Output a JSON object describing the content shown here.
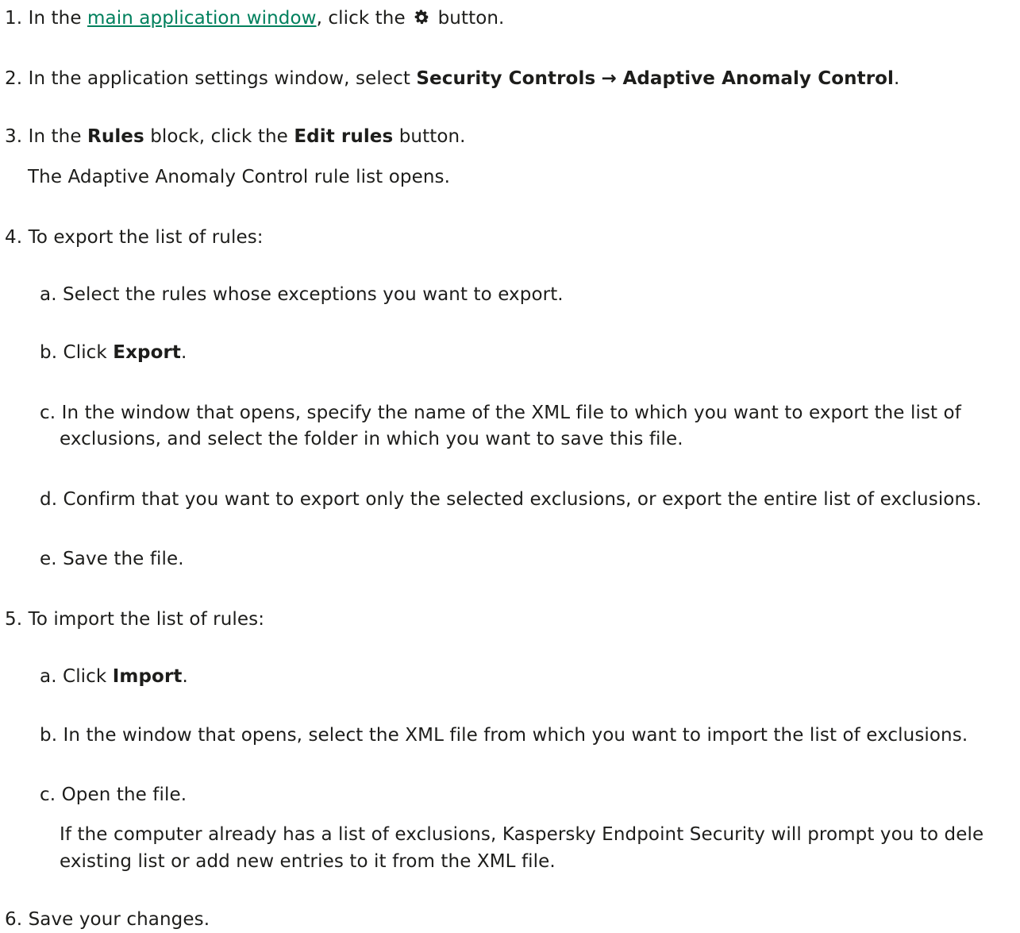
{
  "steps": {
    "s1": {
      "num": "1.",
      "pre": "In the",
      "link": "main application window",
      "post": ", click the",
      "post2": "button.",
      "icon": "gear-icon"
    },
    "s2": {
      "num": "2.",
      "pre": "In the application settings window, select",
      "b1": "Security Controls",
      "arrow": "→",
      "b2": "Adaptive Anomaly Control",
      "end": "."
    },
    "s3": {
      "num": "3.",
      "pre": "In the",
      "b1": "Rules",
      "mid": "block, click the",
      "b2": "Edit rules",
      "post": "button.",
      "note": "The Adaptive Anomaly Control rule list opens."
    },
    "s4": {
      "num": "4.",
      "text": "To export the list of rules:",
      "a": {
        "label": "a.",
        "text": "Select the rules whose exceptions you want to export."
      },
      "b": {
        "label": "b.",
        "pre": "Click",
        "bold": "Export",
        "end": "."
      },
      "c": {
        "label": "c.",
        "line1": "In the window that opens, specify the name of the XML file to which you want to export the list of",
        "line2": "exclusions, and select the folder in which you want to save this file."
      },
      "d": {
        "label": "d.",
        "text": "Confirm that you want to export only the selected exclusions, or export the entire list of exclusions."
      },
      "e": {
        "label": "e.",
        "text": "Save the file."
      }
    },
    "s5": {
      "num": "5.",
      "text": "To import the list of rules:",
      "a": {
        "label": "a.",
        "pre": "Click",
        "bold": "Import",
        "end": "."
      },
      "b": {
        "label": "b.",
        "text": "In the window that opens, select the XML file from which you want to import the list of exclusions."
      },
      "c": {
        "label": "c.",
        "text": "Open the file.",
        "note1": "If the computer already has a list of exclusions, Kaspersky Endpoint Security will prompt you to dele",
        "note2": "existing list or add new entries to it from the XML file."
      }
    },
    "s6": {
      "num": "6.",
      "text": "Save your changes."
    }
  },
  "colors": {
    "text": "#1d1d1b",
    "link": "#00805d"
  }
}
